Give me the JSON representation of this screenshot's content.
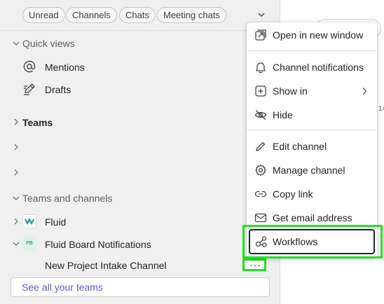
{
  "filters": {
    "chips": [
      "Unread",
      "Channels",
      "Chats",
      "Meeting chats"
    ]
  },
  "quick_views": {
    "label": "Quick views",
    "items": [
      {
        "label": "Mentions",
        "icon": "at-icon"
      },
      {
        "label": "Drafts",
        "icon": "pencil-icon"
      }
    ]
  },
  "teams": {
    "label": "Teams",
    "collapsed_rows": [
      "",
      ""
    ]
  },
  "teams_and_channels": {
    "label": "Teams and channels",
    "teams": [
      {
        "name": "Fluid",
        "logo": "fluid-logo"
      },
      {
        "name": "Fluid Board Notifications",
        "logo_text": "FB",
        "channels": [
          "New Project Intake Channel"
        ]
      }
    ],
    "more_button": "···",
    "see_all": "See all your teams"
  },
  "right_pane": {
    "fragment": "14"
  },
  "context_menu": {
    "items": [
      {
        "label": "Open in new window",
        "icon": "open-new-window-icon"
      },
      {
        "label": "Channel notifications",
        "icon": "bell-icon"
      },
      {
        "label": "Show in",
        "icon": "add-square-icon",
        "submenu": true
      },
      {
        "label": "Hide",
        "icon": "eye-off-icon"
      },
      {
        "label": "Edit channel",
        "icon": "pencil-icon"
      },
      {
        "label": "Manage channel",
        "icon": "gear-icon"
      },
      {
        "label": "Copy link",
        "icon": "link-icon"
      },
      {
        "label": "Get email address",
        "icon": "mail-icon"
      },
      {
        "label": "Workflows",
        "icon": "workflows-icon"
      }
    ]
  },
  "colors": {
    "highlight": "#22e022",
    "accent": "#5b5fc7",
    "sidebar_bg": "#f0f0f0"
  }
}
